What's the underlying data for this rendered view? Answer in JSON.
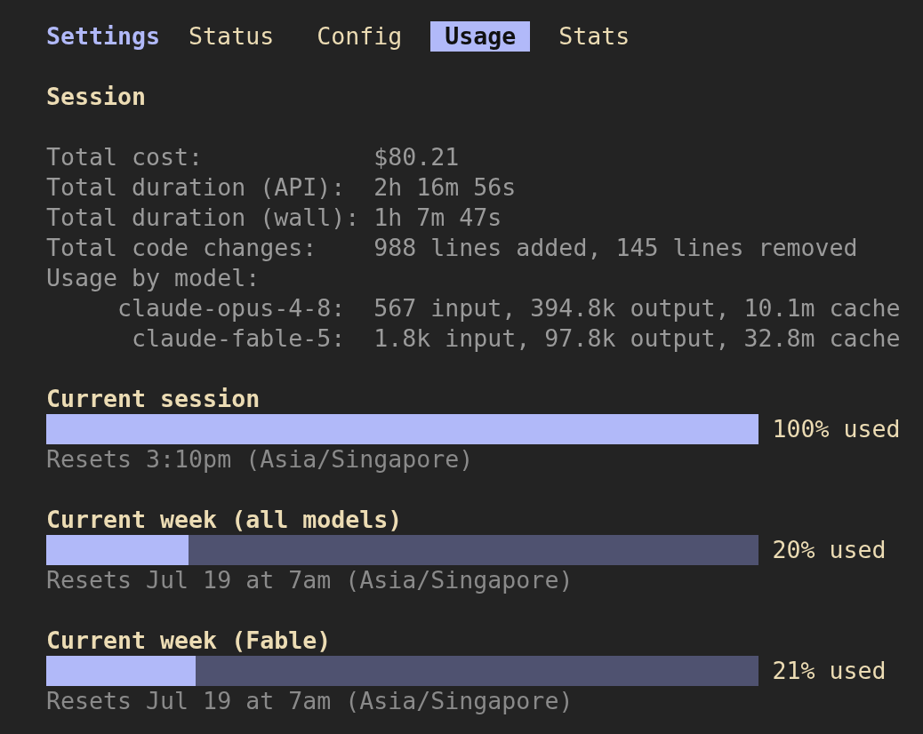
{
  "header": {
    "title": "Settings"
  },
  "tabs": [
    {
      "label": "Status",
      "selected": false
    },
    {
      "label": "Config",
      "selected": false
    },
    {
      "label": "Usage",
      "selected": true
    },
    {
      "label": "Stats",
      "selected": false
    }
  ],
  "session": {
    "heading": "Session",
    "stats": [
      {
        "label": "Total cost:",
        "value": "$80.21"
      },
      {
        "label": "Total duration (API):",
        "value": "2h 16m 56s"
      },
      {
        "label": "Total duration (wall):",
        "value": "1h 7m 47s"
      },
      {
        "label": "Total code changes:",
        "value": "988 lines added, 145 lines removed"
      }
    ],
    "models_label": "Usage by model:",
    "models": [
      {
        "name": "claude-opus-4-8:",
        "usage": "567 input, 394.8k output, 10.1m cache"
      },
      {
        "name": "claude-fable-5:",
        "usage": "1.8k input, 97.8k output, 32.8m cache"
      }
    ]
  },
  "limits": [
    {
      "title": "Current session",
      "level": 1.0,
      "reading": "100% used",
      "resets": "Resets 3:10pm (Asia/Singapore)"
    },
    {
      "title": "Current week (all models)",
      "level": 0.2,
      "reading": "20% used",
      "resets": "Resets Jul 19 at 7am (Asia/Singapore)"
    },
    {
      "title": "Current week (Fable)",
      "level": 0.21,
      "reading": "21% used",
      "resets": "Resets Jul 19 at 7am (Asia/Singapore)"
    }
  ]
}
